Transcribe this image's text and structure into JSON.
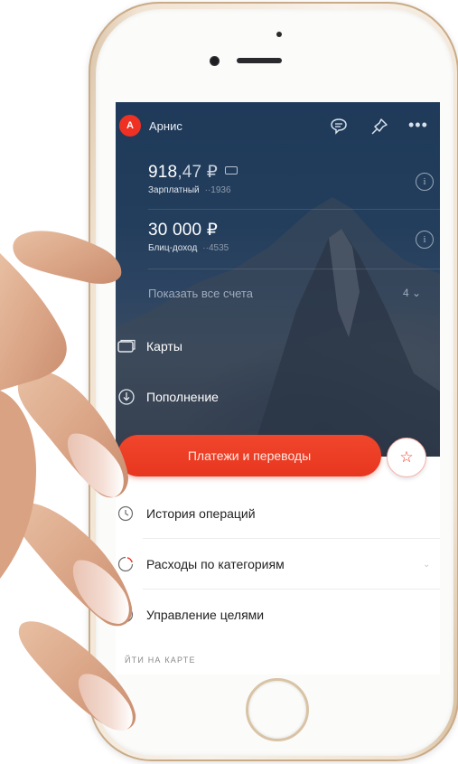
{
  "header": {
    "avatar_letter": "A",
    "user_name": "Арнис"
  },
  "accounts": [
    {
      "amount_int": "918",
      "amount_dec": ",47 ₽",
      "name": "Зарплатный",
      "number": "··1936"
    },
    {
      "amount_int": "30 000 ₽",
      "amount_dec": "",
      "name": "Блиц-доход",
      "number": "··4535"
    }
  ],
  "show_all": {
    "label": "Показать все счета",
    "count": "4"
  },
  "menu_dark": [
    {
      "label": "Карты",
      "icon": "cards-icon"
    },
    {
      "label": "Пополнение",
      "icon": "top-up-icon"
    }
  ],
  "payments_button": "Платежи и переводы",
  "menu_light": [
    {
      "label": "История операций",
      "icon": "history-icon"
    },
    {
      "label": "Расходы по категориям",
      "icon": "chart-icon"
    },
    {
      "label": "Управление целями",
      "icon": "goals-icon"
    }
  ],
  "section_header": "ЙТИ НА КАРТЕ",
  "colors": {
    "brand_red": "#ef3124",
    "screen_dark": "#233e5c",
    "phone_gold": "#e9d6bd"
  }
}
